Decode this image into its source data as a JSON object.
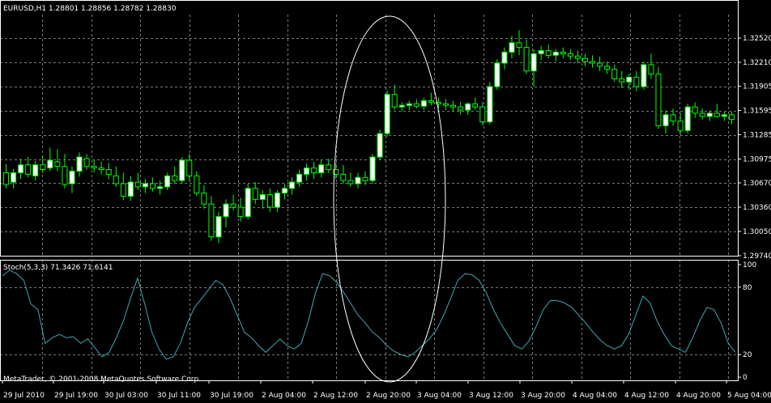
{
  "chart_data": [
    {
      "type": "candlestick",
      "title": "EURUSD,H1  1.28801 1.28856 1.28782 1.28830",
      "ylim": [
        1.2974,
        1.3282
      ],
      "yticks": [
        "1.32520",
        "1.32210",
        "1.31905",
        "1.31595",
        "1.31285",
        "1.30975",
        "1.30670",
        "1.30360",
        "1.30050",
        "1.29740"
      ],
      "ytick_values": [
        1.3252,
        1.3221,
        1.31905,
        1.31595,
        1.31285,
        1.30975,
        1.3067,
        1.3036,
        1.3005,
        1.2974
      ],
      "grid": true,
      "colors": {
        "background": "#000000",
        "grid": "#7a7a7a",
        "bull": "#ffffff",
        "outline": "#00ff00",
        "bear": "#000000"
      },
      "candles": [
        [
          1.308,
          1.3091,
          1.306,
          1.3065
        ],
        [
          1.3068,
          1.3085,
          1.306,
          1.308
        ],
        [
          1.308,
          1.3098,
          1.3072,
          1.309
        ],
        [
          1.309,
          1.31,
          1.3074,
          1.3078
        ],
        [
          1.3076,
          1.3095,
          1.307,
          1.309
        ],
        [
          1.309,
          1.3102,
          1.308,
          1.3084
        ],
        [
          1.3086,
          1.3112,
          1.3082,
          1.3096
        ],
        [
          1.3094,
          1.311,
          1.3082,
          1.3088
        ],
        [
          1.3088,
          1.3104,
          1.306,
          1.3065
        ],
        [
          1.3066,
          1.3088,
          1.3054,
          1.3082
        ],
        [
          1.3082,
          1.3106,
          1.3075,
          1.31
        ],
        [
          1.3098,
          1.3104,
          1.3084,
          1.3088
        ],
        [
          1.3088,
          1.3096,
          1.308,
          1.3086
        ],
        [
          1.3086,
          1.3094,
          1.3078,
          1.3084
        ],
        [
          1.3084,
          1.3092,
          1.3072,
          1.3078
        ],
        [
          1.3076,
          1.3088,
          1.3062,
          1.3066
        ],
        [
          1.3066,
          1.308,
          1.3045,
          1.305
        ],
        [
          1.305,
          1.3076,
          1.3044,
          1.3068
        ],
        [
          1.3068,
          1.308,
          1.3058,
          1.3062
        ],
        [
          1.3062,
          1.3072,
          1.3054,
          1.3066
        ],
        [
          1.3066,
          1.3074,
          1.3056,
          1.306
        ],
        [
          1.306,
          1.307,
          1.3052,
          1.3062
        ],
        [
          1.3062,
          1.308,
          1.3058,
          1.3076
        ],
        [
          1.3076,
          1.3088,
          1.3066,
          1.307
        ],
        [
          1.307,
          1.31,
          1.3066,
          1.3096
        ],
        [
          1.3096,
          1.3104,
          1.307,
          1.3076
        ],
        [
          1.3076,
          1.3082,
          1.305,
          1.3054
        ],
        [
          1.3054,
          1.3064,
          1.3034,
          1.304
        ],
        [
          1.304,
          1.305,
          1.2993,
          1.2998
        ],
        [
          1.2998,
          1.303,
          1.299,
          1.3024
        ],
        [
          1.3024,
          1.3046,
          1.301,
          1.304
        ],
        [
          1.304,
          1.3052,
          1.3032,
          1.3036
        ],
        [
          1.3036,
          1.3048,
          1.3018,
          1.3024
        ],
        [
          1.3024,
          1.3066,
          1.302,
          1.306
        ],
        [
          1.306,
          1.3068,
          1.304,
          1.3046
        ],
        [
          1.3046,
          1.3058,
          1.3034,
          1.3052
        ],
        [
          1.3052,
          1.306,
          1.303,
          1.3036
        ],
        [
          1.3036,
          1.3058,
          1.303,
          1.3054
        ],
        [
          1.3054,
          1.3066,
          1.3046,
          1.306
        ],
        [
          1.306,
          1.3074,
          1.3052,
          1.3068
        ],
        [
          1.3068,
          1.3084,
          1.3062,
          1.3078
        ],
        [
          1.3078,
          1.3092,
          1.307,
          1.3086
        ],
        [
          1.3086,
          1.3094,
          1.3072,
          1.308
        ],
        [
          1.308,
          1.3096,
          1.3074,
          1.309
        ],
        [
          1.309,
          1.3098,
          1.308,
          1.3084
        ],
        [
          1.3084,
          1.3092,
          1.3072,
          1.3078
        ],
        [
          1.3078,
          1.309,
          1.3066,
          1.307
        ],
        [
          1.307,
          1.308,
          1.3062,
          1.3066
        ],
        [
          1.3066,
          1.308,
          1.306,
          1.3074
        ],
        [
          1.3074,
          1.3082,
          1.3064,
          1.307
        ],
        [
          1.307,
          1.3104,
          1.3066,
          1.31
        ],
        [
          1.31,
          1.3135,
          1.3096,
          1.313
        ],
        [
          1.313,
          1.3185,
          1.3126,
          1.318
        ],
        [
          1.318,
          1.3192,
          1.316,
          1.3164
        ],
        [
          1.3164,
          1.317,
          1.3158,
          1.3166
        ],
        [
          1.3166,
          1.3172,
          1.316,
          1.3168
        ],
        [
          1.3168,
          1.3174,
          1.3162,
          1.3165
        ],
        [
          1.3165,
          1.3176,
          1.316,
          1.3172
        ],
        [
          1.3172,
          1.3182,
          1.3166,
          1.317
        ],
        [
          1.317,
          1.3176,
          1.3162,
          1.3168
        ],
        [
          1.3168,
          1.3174,
          1.316,
          1.3166
        ],
        [
          1.3166,
          1.3172,
          1.3158,
          1.3164
        ],
        [
          1.3164,
          1.317,
          1.3154,
          1.316
        ],
        [
          1.316,
          1.317,
          1.3154,
          1.3168
        ],
        [
          1.3168,
          1.3176,
          1.316,
          1.3164
        ],
        [
          1.3164,
          1.317,
          1.314,
          1.3145
        ],
        [
          1.3145,
          1.3196,
          1.3142,
          1.319
        ],
        [
          1.319,
          1.3225,
          1.3186,
          1.322
        ],
        [
          1.322,
          1.324,
          1.3212,
          1.3234
        ],
        [
          1.3234,
          1.3255,
          1.3226,
          1.3246
        ],
        [
          1.3246,
          1.3262,
          1.323,
          1.324
        ],
        [
          1.324,
          1.325,
          1.3206,
          1.321
        ],
        [
          1.321,
          1.3238,
          1.319,
          1.3232
        ],
        [
          1.3232,
          1.3242,
          1.3224,
          1.3236
        ],
        [
          1.3236,
          1.3244,
          1.3226,
          1.323
        ],
        [
          1.323,
          1.3238,
          1.3222,
          1.3234
        ],
        [
          1.3234,
          1.324,
          1.3226,
          1.3232
        ],
        [
          1.3232,
          1.3238,
          1.3224,
          1.3229
        ],
        [
          1.3229,
          1.3236,
          1.322,
          1.3226
        ],
        [
          1.3226,
          1.3232,
          1.3216,
          1.3222
        ],
        [
          1.3222,
          1.323,
          1.3214,
          1.322
        ],
        [
          1.322,
          1.3228,
          1.321,
          1.3216
        ],
        [
          1.3216,
          1.3222,
          1.3206,
          1.3212
        ],
        [
          1.3212,
          1.3218,
          1.3196,
          1.32
        ],
        [
          1.32,
          1.321,
          1.3188,
          1.3196
        ],
        [
          1.3196,
          1.3206,
          1.3186,
          1.3202
        ],
        [
          1.3202,
          1.321,
          1.3184,
          1.319
        ],
        [
          1.319,
          1.3222,
          1.3186,
          1.3218
        ],
        [
          1.3218,
          1.3232,
          1.32,
          1.3206
        ],
        [
          1.3206,
          1.3215,
          1.3136,
          1.314
        ],
        [
          1.314,
          1.316,
          1.313,
          1.3154
        ],
        [
          1.3154,
          1.3162,
          1.314,
          1.3146
        ],
        [
          1.3146,
          1.3156,
          1.3128,
          1.3134
        ],
        [
          1.3134,
          1.3168,
          1.313,
          1.3164
        ],
        [
          1.3164,
          1.317,
          1.315,
          1.3156
        ],
        [
          1.3156,
          1.3162,
          1.3148,
          1.3152
        ],
        [
          1.3152,
          1.316,
          1.3146,
          1.3156
        ],
        [
          1.3156,
          1.3168,
          1.315,
          1.3152
        ],
        [
          1.3152,
          1.3158,
          1.3146,
          1.3154
        ],
        [
          1.3154,
          1.3158,
          1.3142,
          1.3148
        ]
      ]
    },
    {
      "type": "line",
      "title": "Stoch(5,3,3) 71.3426 71.6141",
      "ylim": [
        0,
        100
      ],
      "yticks": [
        "100",
        "80",
        "20",
        "0"
      ],
      "ytick_values": [
        100,
        80,
        20,
        0
      ],
      "levels": [
        20,
        80
      ],
      "colors": {
        "main": "#3fa8b4",
        "level": "#7a7a7a"
      },
      "series": [
        {
          "values": [
            90,
            95,
            92,
            86,
            65,
            60,
            30,
            35,
            38,
            35,
            36,
            30,
            34,
            26,
            18,
            22,
            35,
            50,
            70,
            88,
            65,
            40,
            25,
            16,
            18,
            30,
            48,
            62,
            70,
            78,
            86,
            82,
            70,
            55,
            40,
            35,
            28,
            22,
            28,
            34,
            28,
            25,
            30,
            50,
            75,
            92,
            90,
            84,
            75,
            65,
            55,
            48,
            40,
            35,
            28,
            23,
            20,
            18,
            22,
            28,
            34,
            42,
            55,
            70,
            86,
            92,
            91,
            86,
            75,
            60,
            48,
            38,
            28,
            25,
            32,
            45,
            60,
            68,
            68,
            66,
            62,
            55,
            48,
            40,
            33,
            28,
            25,
            28,
            38,
            55,
            72,
            66,
            50,
            38,
            28,
            25,
            22,
            35,
            50,
            62,
            60,
            48,
            30,
            22
          ]
        }
      ]
    }
  ],
  "xaxis": {
    "labels": [
      "29 Jul 2010",
      "29 Jul 19:00",
      "30 Jul 03:00",
      "30 Jul 11:00",
      "30 Jul 19:00",
      "2 Aug 04:00",
      "2 Aug 12:00",
      "2 Aug 20:00",
      "3 Aug 04:00",
      "3 Aug 12:00",
      "3 Aug 20:00",
      "4 Aug 04:00",
      "4 Aug 12:00",
      "4 Aug 20:00",
      "5 Aug 04:00"
    ]
  },
  "footer": {
    "copyright": "MetaTrader, © 2001-2008 MetaQuotes Software Corp."
  },
  "annotation": {
    "shape": "ellipse",
    "color": "#ffffff"
  }
}
